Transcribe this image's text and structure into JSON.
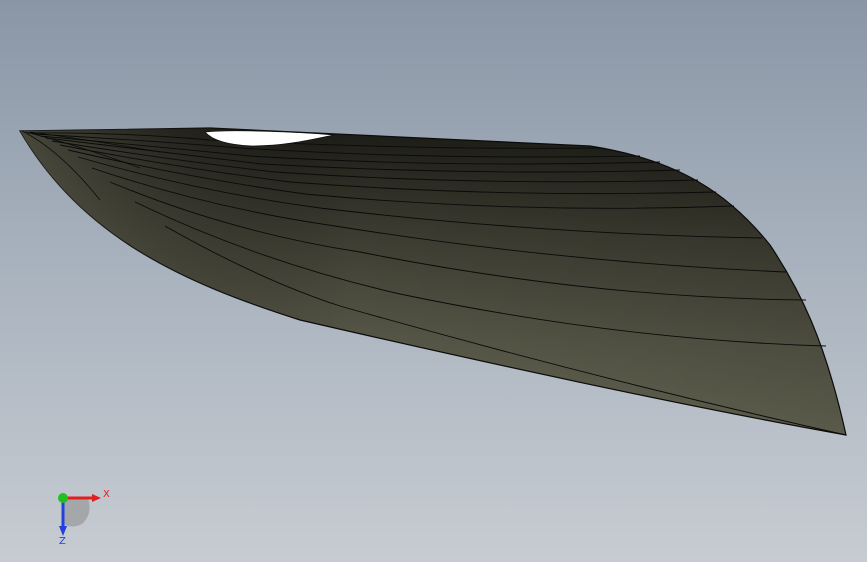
{
  "viewport": {
    "background_top": "#8a96a6",
    "background_bottom": "#c7ccd2"
  },
  "model": {
    "shape": "lofted hull surface",
    "fill_color": "#5b5b4c",
    "edge_color": "#111111",
    "opening_color": "#ffffff"
  },
  "triad": {
    "x_label": "X",
    "z_label": "Z",
    "x_color": "#e02020",
    "y_color": "#20c020",
    "z_color": "#2040e0"
  }
}
